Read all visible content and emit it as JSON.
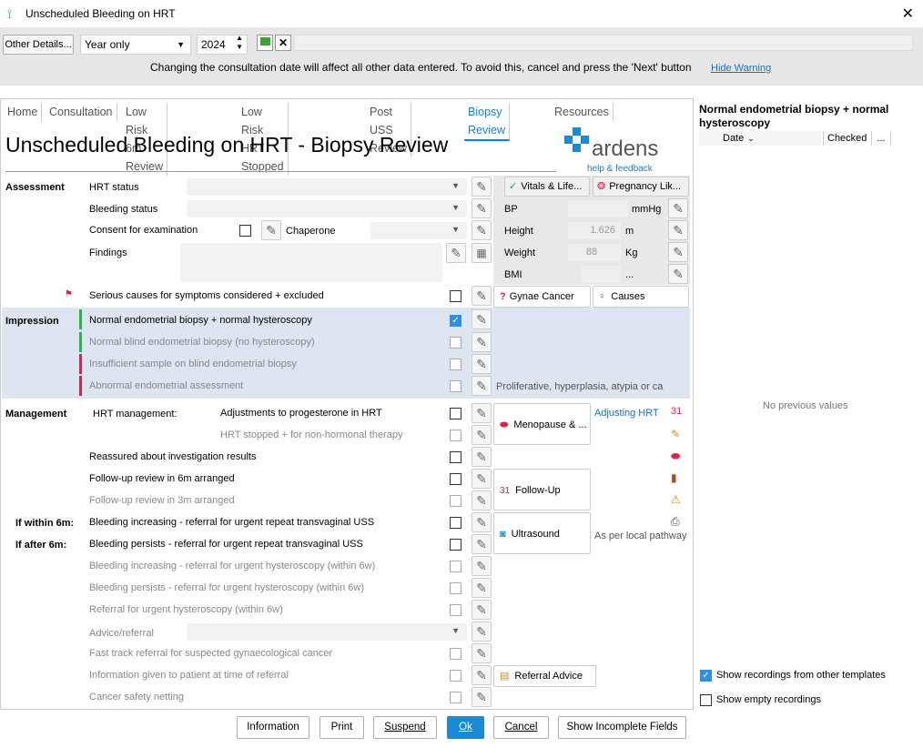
{
  "window": {
    "title": "Unscheduled Bleeding on HRT",
    "close": "✕"
  },
  "toolbar": {
    "other_details": "Other Details...",
    "date_mode": "Year only",
    "year": "2024",
    "warning": "Changing the consultation date will affect all other data entered. To avoid this, cancel and press the 'Next' button",
    "hide_warning": "Hide Warning"
  },
  "tabs": [
    "Home",
    "Consultation",
    "Low Risk 6m Review",
    "Low Risk HRT Stopped",
    "Post USS Review",
    "Biopsy Review",
    "Resources"
  ],
  "page_title": "Unscheduled Bleeding on HRT - Biopsy Review",
  "logo": {
    "name": "ardens",
    "sub": "help & feedback"
  },
  "assessment": {
    "section": "Assessment",
    "hrt_status": "HRT status",
    "bleeding_status": "Bleeding status",
    "consent": "Consent for examination",
    "chaperone": "Chaperone",
    "findings": "Findings",
    "serious": "Serious causes for symptoms considered + excluded"
  },
  "vitals": {
    "vitals_btn": "Vitals & Life...",
    "pregnancy_btn": "Pregnancy Lik...",
    "bp": "BP",
    "bp_unit": "mmHg",
    "height": "Height",
    "height_val": "1.626",
    "height_unit": "m",
    "weight": "Weight",
    "weight_val": "88",
    "weight_unit": "Kg",
    "bmi": "BMI",
    "bmi_unit": "..."
  },
  "buttons": {
    "gynae": "Gynae Cancer",
    "causes": "Causes",
    "menopause": "Menopause & ...",
    "followup": "Follow-Up",
    "ultrasound": "Ultrasound",
    "referral_advice": "Referral Advice"
  },
  "impression": {
    "section": "Impression",
    "items": [
      "Normal endometrial biopsy + normal hysteroscopy",
      "Normal blind endometrial biopsy (no hysteroscopy)",
      "Insufficient sample on blind endometrial biopsy",
      "Abnormal endometrial assessment"
    ],
    "note": "Proliferative, hyperplasia, atypia or ca"
  },
  "management": {
    "section": "Management",
    "hrt_mgmt": "HRT management:",
    "adj_prog": "Adjustments to progesterone in HRT",
    "hrt_stopped": "HRT stopped + for non-hormonal therapy",
    "adjusting_link": "Adjusting HRT",
    "reassured": "Reassured about investigation results",
    "fu6": "Follow-up review in 6m arranged",
    "fu3": "Follow-up review in 3m arranged",
    "within6": "If within 6m:",
    "after6": "If after 6m:",
    "bleed_inc_tv": "Bleeding increasing - referral for urgent repeat transvaginal USS",
    "bleed_per_tv": "Bleeding persists - referral for urgent repeat transvaginal USS",
    "local_pathway": "As per local pathway",
    "bleed_inc_hy": "Bleeding increasing - referral for urgent hysteroscopy (within 6w)",
    "bleed_per_hy": "Bleeding persists - referral for urgent hysteroscopy (within 6w)",
    "ref_hy": "Referral for urgent hysteroscopy (within 6w)",
    "advice": "Advice/referral",
    "fast_track": "Fast track referral for suspected gynaecological cancer",
    "info_given": "Information given to patient at time of referral",
    "safety": "Cancer safety netting"
  },
  "side": {
    "title": "Normal endometrial biopsy + normal hysteroscopy",
    "col_date": "Date",
    "col_checked": "Checked",
    "col_more": "...",
    "empty": "No previous values",
    "show_other": "Show recordings from other templates",
    "show_empty": "Show empty recordings"
  },
  "footer": {
    "information": "Information",
    "print": "Print",
    "suspend": "Suspend",
    "ok": "Ok",
    "cancel": "Cancel",
    "incomplete": "Show Incomplete Fields"
  },
  "colors": {
    "accent": "#1a7fd0",
    "green_bar": "#2db34a",
    "red_bar": "#e0204a",
    "shade": "#dde6f0"
  }
}
